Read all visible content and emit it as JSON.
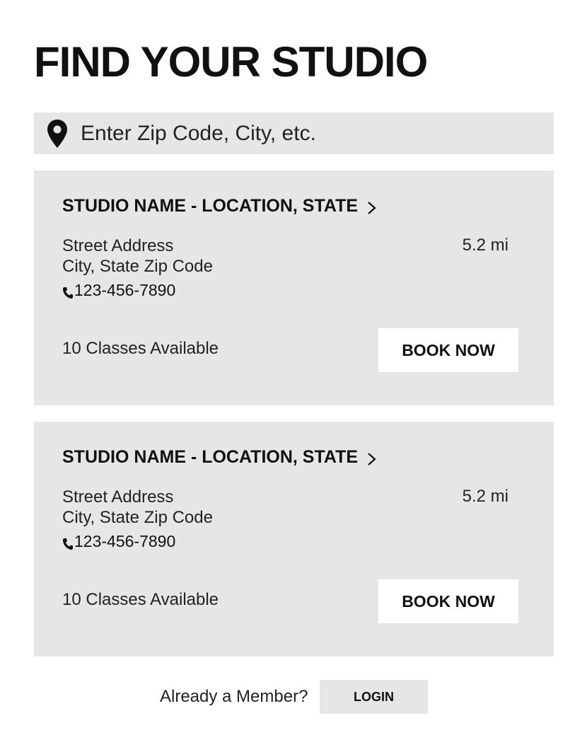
{
  "header": {
    "title": "FIND YOUR STUDIO"
  },
  "search": {
    "placeholder": "Enter Zip Code, City, etc.",
    "value": "",
    "icon": "map-pin-icon"
  },
  "studios": [
    {
      "name": "STUDIO NAME - LOCATION, STATE",
      "street": "Street Address",
      "city_line": "City, State Zip Code",
      "phone": "123-456-7890",
      "distance": "5.2 mi",
      "classes": "10 Classes Available",
      "book_label": "BOOK NOW"
    },
    {
      "name": "STUDIO NAME - LOCATION, STATE",
      "street": "Street Address",
      "city_line": "City, State Zip Code",
      "phone": "123-456-7890",
      "distance": "5.2 mi",
      "classes": "10 Classes Available",
      "book_label": "BOOK NOW"
    }
  ],
  "footer": {
    "member_prompt": "Already a Member?",
    "login_label": "LOGIN"
  },
  "colors": {
    "panel": "#e6e6e6",
    "text": "#111111",
    "button_bg": "#ffffff"
  }
}
